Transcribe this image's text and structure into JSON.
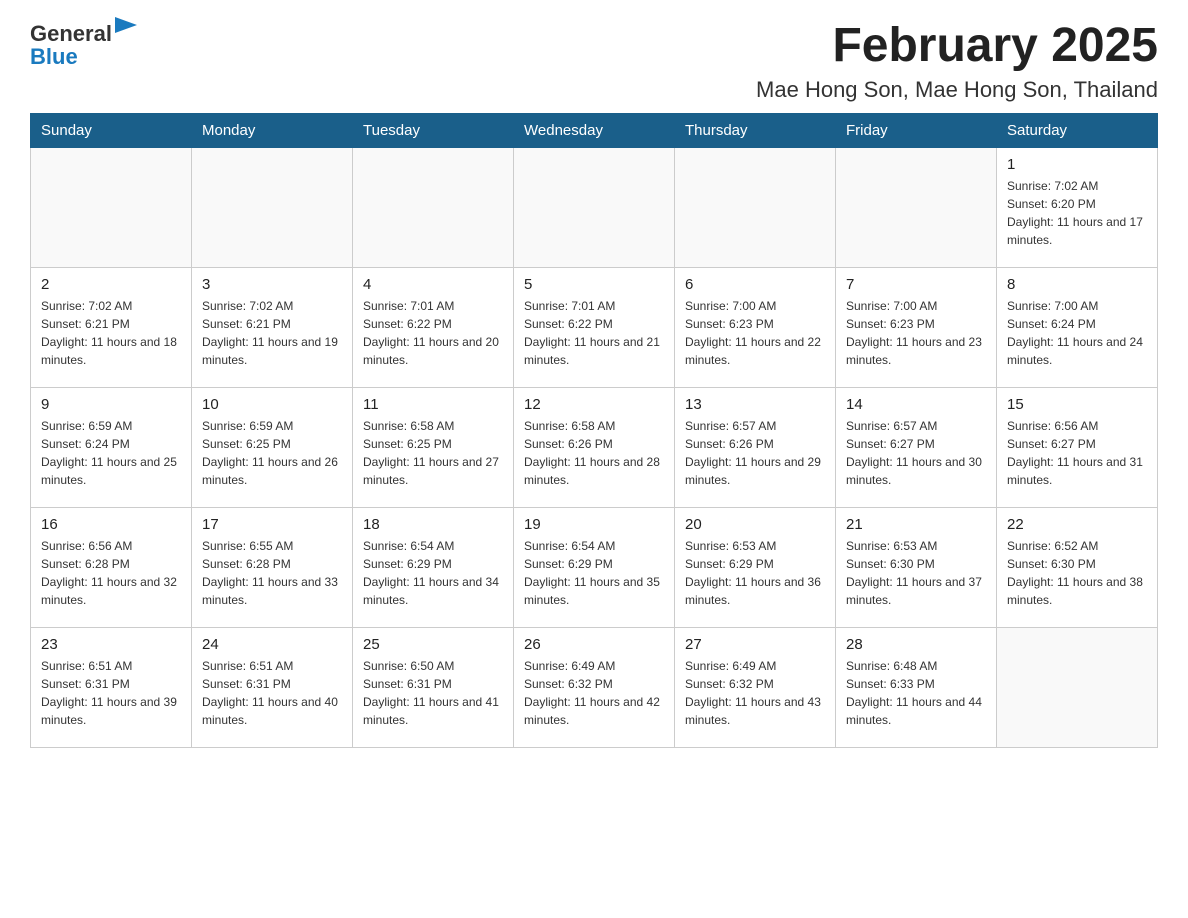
{
  "header": {
    "logo": {
      "text_general": "General",
      "text_blue": "Blue"
    },
    "month_title": "February 2025",
    "location": "Mae Hong Son, Mae Hong Son, Thailand"
  },
  "days_of_week": [
    "Sunday",
    "Monday",
    "Tuesday",
    "Wednesday",
    "Thursday",
    "Friday",
    "Saturday"
  ],
  "weeks": [
    [
      {
        "day": "",
        "info": ""
      },
      {
        "day": "",
        "info": ""
      },
      {
        "day": "",
        "info": ""
      },
      {
        "day": "",
        "info": ""
      },
      {
        "day": "",
        "info": ""
      },
      {
        "day": "",
        "info": ""
      },
      {
        "day": "1",
        "info": "Sunrise: 7:02 AM\nSunset: 6:20 PM\nDaylight: 11 hours and 17 minutes."
      }
    ],
    [
      {
        "day": "2",
        "info": "Sunrise: 7:02 AM\nSunset: 6:21 PM\nDaylight: 11 hours and 18 minutes."
      },
      {
        "day": "3",
        "info": "Sunrise: 7:02 AM\nSunset: 6:21 PM\nDaylight: 11 hours and 19 minutes."
      },
      {
        "day": "4",
        "info": "Sunrise: 7:01 AM\nSunset: 6:22 PM\nDaylight: 11 hours and 20 minutes."
      },
      {
        "day": "5",
        "info": "Sunrise: 7:01 AM\nSunset: 6:22 PM\nDaylight: 11 hours and 21 minutes."
      },
      {
        "day": "6",
        "info": "Sunrise: 7:00 AM\nSunset: 6:23 PM\nDaylight: 11 hours and 22 minutes."
      },
      {
        "day": "7",
        "info": "Sunrise: 7:00 AM\nSunset: 6:23 PM\nDaylight: 11 hours and 23 minutes."
      },
      {
        "day": "8",
        "info": "Sunrise: 7:00 AM\nSunset: 6:24 PM\nDaylight: 11 hours and 24 minutes."
      }
    ],
    [
      {
        "day": "9",
        "info": "Sunrise: 6:59 AM\nSunset: 6:24 PM\nDaylight: 11 hours and 25 minutes."
      },
      {
        "day": "10",
        "info": "Sunrise: 6:59 AM\nSunset: 6:25 PM\nDaylight: 11 hours and 26 minutes."
      },
      {
        "day": "11",
        "info": "Sunrise: 6:58 AM\nSunset: 6:25 PM\nDaylight: 11 hours and 27 minutes."
      },
      {
        "day": "12",
        "info": "Sunrise: 6:58 AM\nSunset: 6:26 PM\nDaylight: 11 hours and 28 minutes."
      },
      {
        "day": "13",
        "info": "Sunrise: 6:57 AM\nSunset: 6:26 PM\nDaylight: 11 hours and 29 minutes."
      },
      {
        "day": "14",
        "info": "Sunrise: 6:57 AM\nSunset: 6:27 PM\nDaylight: 11 hours and 30 minutes."
      },
      {
        "day": "15",
        "info": "Sunrise: 6:56 AM\nSunset: 6:27 PM\nDaylight: 11 hours and 31 minutes."
      }
    ],
    [
      {
        "day": "16",
        "info": "Sunrise: 6:56 AM\nSunset: 6:28 PM\nDaylight: 11 hours and 32 minutes."
      },
      {
        "day": "17",
        "info": "Sunrise: 6:55 AM\nSunset: 6:28 PM\nDaylight: 11 hours and 33 minutes."
      },
      {
        "day": "18",
        "info": "Sunrise: 6:54 AM\nSunset: 6:29 PM\nDaylight: 11 hours and 34 minutes."
      },
      {
        "day": "19",
        "info": "Sunrise: 6:54 AM\nSunset: 6:29 PM\nDaylight: 11 hours and 35 minutes."
      },
      {
        "day": "20",
        "info": "Sunrise: 6:53 AM\nSunset: 6:29 PM\nDaylight: 11 hours and 36 minutes."
      },
      {
        "day": "21",
        "info": "Sunrise: 6:53 AM\nSunset: 6:30 PM\nDaylight: 11 hours and 37 minutes."
      },
      {
        "day": "22",
        "info": "Sunrise: 6:52 AM\nSunset: 6:30 PM\nDaylight: 11 hours and 38 minutes."
      }
    ],
    [
      {
        "day": "23",
        "info": "Sunrise: 6:51 AM\nSunset: 6:31 PM\nDaylight: 11 hours and 39 minutes."
      },
      {
        "day": "24",
        "info": "Sunrise: 6:51 AM\nSunset: 6:31 PM\nDaylight: 11 hours and 40 minutes."
      },
      {
        "day": "25",
        "info": "Sunrise: 6:50 AM\nSunset: 6:31 PM\nDaylight: 11 hours and 41 minutes."
      },
      {
        "day": "26",
        "info": "Sunrise: 6:49 AM\nSunset: 6:32 PM\nDaylight: 11 hours and 42 minutes."
      },
      {
        "day": "27",
        "info": "Sunrise: 6:49 AM\nSunset: 6:32 PM\nDaylight: 11 hours and 43 minutes."
      },
      {
        "day": "28",
        "info": "Sunrise: 6:48 AM\nSunset: 6:33 PM\nDaylight: 11 hours and 44 minutes."
      },
      {
        "day": "",
        "info": ""
      }
    ]
  ]
}
